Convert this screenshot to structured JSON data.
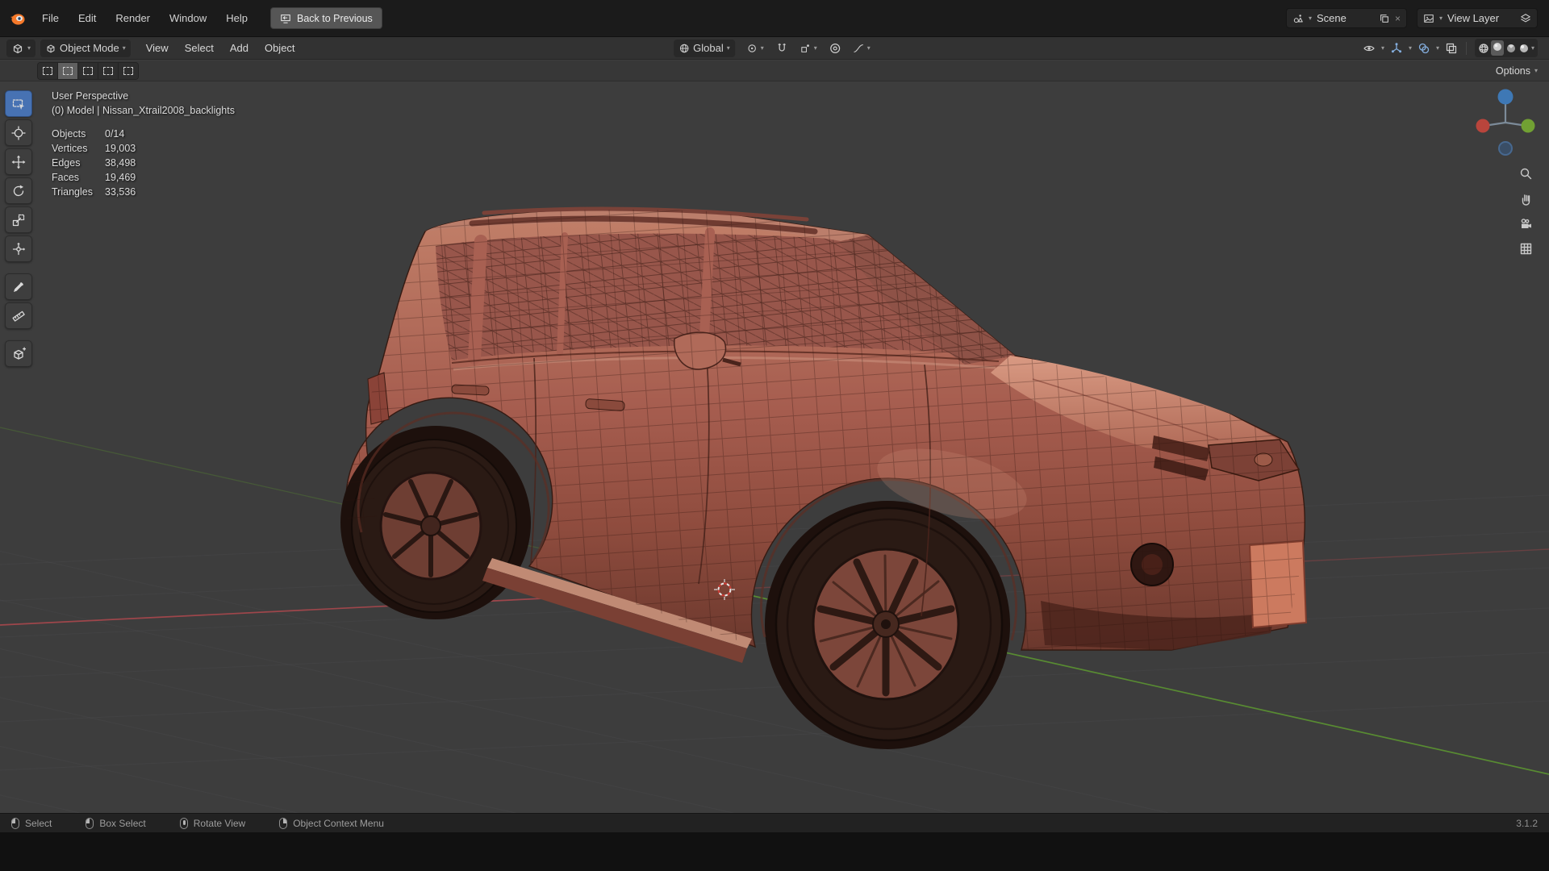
{
  "topbar": {
    "app_menus": [
      {
        "label": "File"
      },
      {
        "label": "Edit"
      },
      {
        "label": "Render"
      },
      {
        "label": "Window"
      },
      {
        "label": "Help"
      }
    ],
    "back_button": {
      "label": "Back to Previous"
    },
    "scene_selector": {
      "label": "Scene"
    },
    "view_layer_selector": {
      "label": "View Layer"
    }
  },
  "viewport_header": {
    "mode_selector": {
      "label": "Object Mode"
    },
    "menus": [
      {
        "label": "View"
      },
      {
        "label": "Select"
      },
      {
        "label": "Add"
      },
      {
        "label": "Object"
      }
    ],
    "transform_orientation": {
      "label": "Global"
    },
    "shading_modes": [
      "wireframe",
      "solid",
      "material-preview",
      "rendered"
    ],
    "active_shading_mode": "solid"
  },
  "tool_settings": {
    "select_modes": [
      "set",
      "extend",
      "subtract",
      "invert",
      "intersect"
    ],
    "active_select_mode": "extend",
    "options_button": {
      "label": "Options"
    }
  },
  "tool_shelf": {
    "tools": [
      "box-select",
      "cursor",
      "move",
      "rotate",
      "scale",
      "transform",
      "annotate",
      "measure",
      "add-cube"
    ],
    "active_tool": "box-select"
  },
  "viewport": {
    "view_label": "User Perspective",
    "active_object_label": "(0) Model | Nissan_Xtrail2008_backlights",
    "stats": [
      {
        "label": "Objects",
        "value": "0/14"
      },
      {
        "label": "Vertices",
        "value": "19,003"
      },
      {
        "label": "Edges",
        "value": "38,498"
      },
      {
        "label": "Faces",
        "value": "19,469"
      },
      {
        "label": "Triangles",
        "value": "33,536"
      }
    ]
  },
  "scene_3d": {
    "model_name": "Nissan_Xtrail2008_backlights",
    "model_color": "#a96054",
    "wireframe_color": "#2b110c",
    "background_color": "#3d3d3d",
    "axis_x_color": "#a8474c",
    "axis_y_color": "#5d9930"
  },
  "status_bar": {
    "hints": [
      {
        "label": "Select"
      },
      {
        "label": "Box Select"
      },
      {
        "label": "Rotate View"
      },
      {
        "label": "Object Context Menu"
      }
    ],
    "version": "3.1.2"
  },
  "icons": {
    "chevron_down": "▾",
    "close": "×"
  }
}
